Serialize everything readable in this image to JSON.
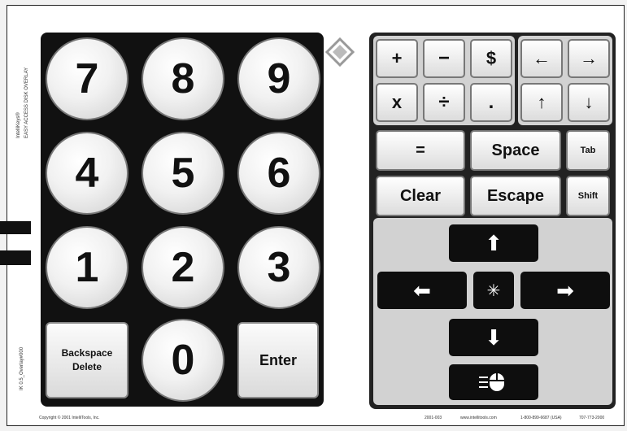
{
  "margin_text": {
    "top_lines": [
      "IntelliKeys®",
      "EASY ACCESS DISK OVERLAY"
    ],
    "bottom_line": "IK 0.5_Overlay#000"
  },
  "numpad": {
    "keys": [
      "7",
      "8",
      "9",
      "4",
      "5",
      "6",
      "1",
      "2",
      "3",
      "0"
    ],
    "backspace_line1": "Backspace",
    "backspace_line2": "Delete",
    "enter": "Enter"
  },
  "operators": {
    "plus": "+",
    "minus": "−",
    "dollar": "$",
    "times": "x",
    "divide": "÷",
    "dot": "."
  },
  "arrow_keys": {
    "left": "←",
    "right": "→",
    "up": "↑",
    "down": "↓"
  },
  "function_keys": {
    "equals": "=",
    "space": "Space",
    "tab": "Tab",
    "clear": "Clear",
    "escape": "Escape",
    "shift": "Shift"
  },
  "mouse_nav": {
    "up": "⬆",
    "down": "⬇",
    "left": "⬅",
    "right": "➡",
    "center": "✳",
    "click": "⬤"
  },
  "footer": {
    "copyright": "Copyright © 2001 IntelliTools, Inc.",
    "right_text": [
      "2001-003",
      "www.intellitools.com",
      "1-800-899-6687 (USA)",
      "707-773-2000"
    ]
  }
}
